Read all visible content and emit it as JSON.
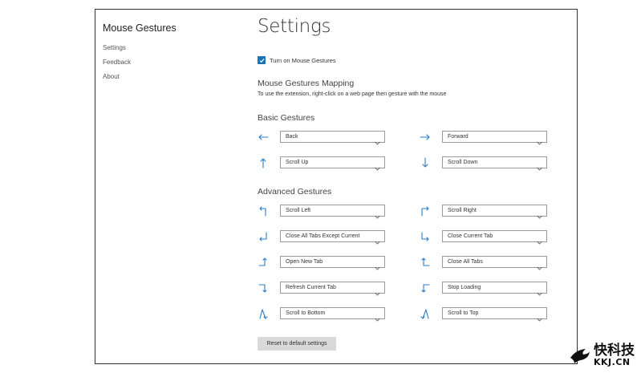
{
  "sidebar": {
    "app_title": "Mouse Gestures",
    "items": [
      {
        "label": "Settings"
      },
      {
        "label": "Feedback"
      },
      {
        "label": "About"
      }
    ]
  },
  "main": {
    "title": "Settings",
    "toggle": {
      "label": "Turn on Mouse Gestures",
      "checked": true
    },
    "mapping_heading": "Mouse Gestures Mapping",
    "mapping_desc": "To use the extension, right-click on a web page then gesture with the mouse",
    "basic_heading": "Basic Gestures",
    "basic": [
      {
        "arrow": "arrow-left-icon",
        "value": "Back"
      },
      {
        "arrow": "arrow-right-icon",
        "value": "Forward"
      },
      {
        "arrow": "arrow-up-icon",
        "value": "Scroll Up"
      },
      {
        "arrow": "arrow-down-icon",
        "value": "Scroll Down"
      }
    ],
    "advanced_heading": "Advanced Gestures",
    "advanced": [
      {
        "arrow": "up-left-icon",
        "value": "Scroll Left"
      },
      {
        "arrow": "up-right-icon",
        "value": "Scroll Right"
      },
      {
        "arrow": "down-left-icon",
        "value": "Close All Tabs Except Current"
      },
      {
        "arrow": "down-right-icon",
        "value": "Close Current Tab"
      },
      {
        "arrow": "right-up-icon",
        "value": "Open New Tab"
      },
      {
        "arrow": "left-up-icon",
        "value": "Close All Tabs"
      },
      {
        "arrow": "right-down-icon",
        "value": "Refresh Current Tab"
      },
      {
        "arrow": "left-down-icon",
        "value": "Stop Loading"
      },
      {
        "arrow": "up-down-left-icon",
        "value": "Scroll to Bottom"
      },
      {
        "arrow": "up-down-right-icon",
        "value": "Scroll to Top"
      }
    ],
    "reset_label": "Reset to default settings"
  },
  "colors": {
    "accent": "#2a7cc7",
    "checkbox": "#1e73b8",
    "button_bg": "#d9d9d9"
  },
  "watermark": {
    "cn": "快科技",
    "en": "KKJ.CN"
  }
}
